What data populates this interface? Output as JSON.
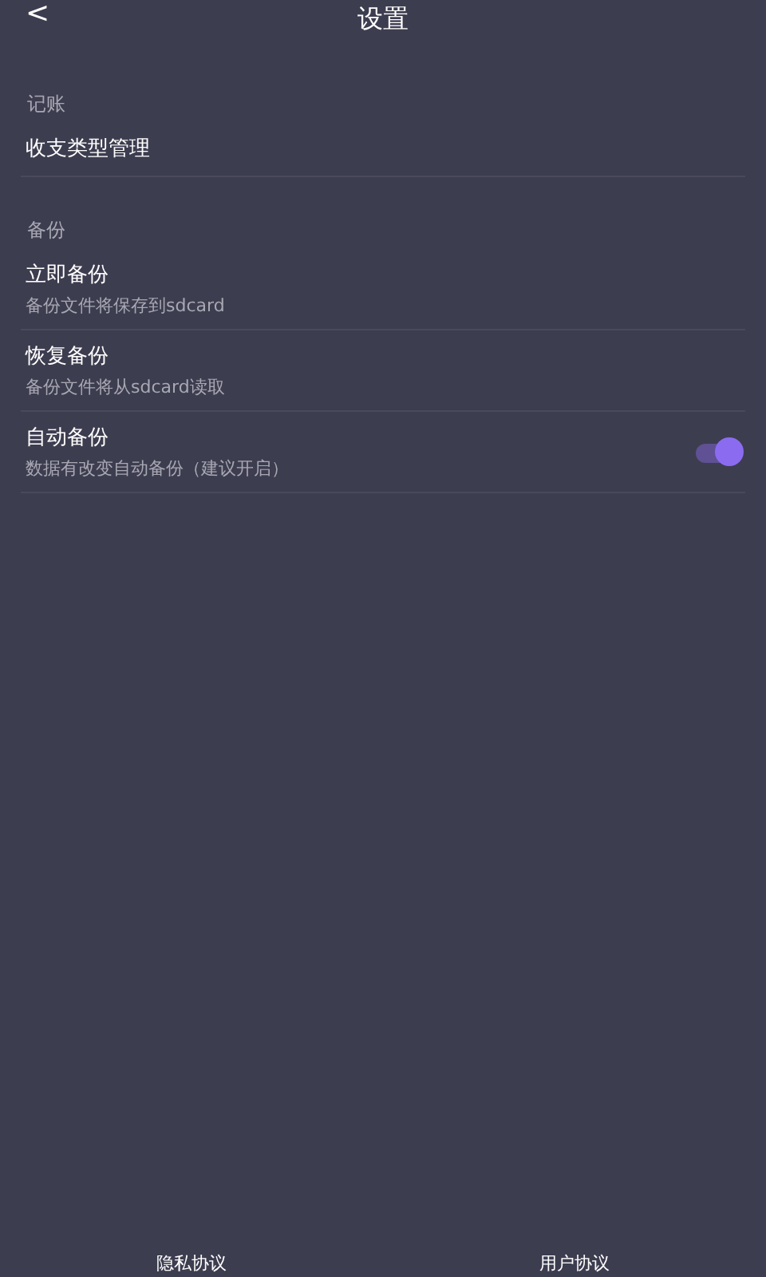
{
  "header": {
    "back": "<",
    "title": "设置"
  },
  "sections": [
    {
      "label": "记账",
      "items": [
        {
          "kind": "plain",
          "title": "收支类型管理"
        }
      ]
    },
    {
      "label": "备份",
      "items": [
        {
          "kind": "plain",
          "title": "立即备份",
          "subtitle": "备份文件将保存到sdcard"
        },
        {
          "kind": "plain",
          "title": "恢复备份",
          "subtitle": "备份文件将从sdcard读取"
        },
        {
          "kind": "toggle",
          "title": "自动备份",
          "subtitle": "数据有改变自动备份（建议开启）",
          "on": true
        }
      ]
    }
  ],
  "footer_links": [
    "隐私协议",
    "用户协议"
  ]
}
